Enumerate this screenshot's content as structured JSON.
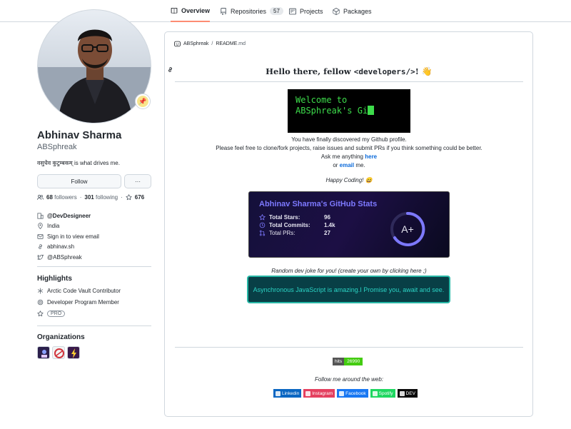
{
  "nav": {
    "tabs": [
      {
        "label": "Overview",
        "icon": "book-icon"
      },
      {
        "label": "Repositories",
        "icon": "repo-icon",
        "count": "57"
      },
      {
        "label": "Projects",
        "icon": "project-icon"
      },
      {
        "label": "Packages",
        "icon": "package-icon"
      }
    ]
  },
  "profile": {
    "name": "Abhinav Sharma",
    "login": "ABSphreak",
    "bio": "वसुधैव कुटुम्बकम् is what drives me.",
    "follow_label": "Follow",
    "more_label": "···",
    "followers_count": "68",
    "followers_label": "followers",
    "following_count": "301",
    "following_label": "following",
    "stars_count": "676",
    "company": "@DevDesigneer",
    "location": "India",
    "email": "Sign in to view email",
    "website": "abhinav.sh",
    "twitter": "@ABSphreak"
  },
  "highlights": {
    "title": "Highlights",
    "items": [
      "Arctic Code Vault Contributor",
      "Developer Program Member"
    ],
    "pro": "PRO"
  },
  "organizations": {
    "title": "Organizations",
    "colors": [
      "#2b1f4b",
      "#f4f4f4",
      "#3a1a4a"
    ]
  },
  "readme": {
    "owner": "ABSphreak",
    "separator": "/",
    "file": "README",
    "ext": ".md",
    "heading_start": "Hello there, fellow ",
    "heading_code": "<developers/>",
    "heading_end": "!",
    "terminal_line1": "Welcome to",
    "terminal_line2": "ABSphreak's Gi",
    "line1": "You have finally discovered my Github profile.",
    "line2": "Please feel free to clone/fork projects, raise issues and submit PRs if you think something could be better.",
    "line3_text": "Ask me anything ",
    "line3_link": "here",
    "line4_pre": "or ",
    "line4_link": "email",
    "line4_post": " me.",
    "happy": "Happy Coding! ",
    "stats": {
      "title": "Abhinav Sharma's GitHub Stats",
      "rows": [
        {
          "label": "Total Stars:",
          "value": "96"
        },
        {
          "label": "Total Commits:",
          "value": "1.4k"
        },
        {
          "label": "Total PRs:",
          "value": "27"
        }
      ],
      "grade": "A+",
      "title_color": "#7d79ff",
      "ring_color": "#7d79ff"
    },
    "joke_label": "Random dev joke for you! (create your own by clicking here ;)",
    "joke": "Asynchronous JavaScript is amazing.I Promise you, await and see.",
    "hits_label": "hits",
    "hits_value": "26990",
    "follow_web": "Follow me around the web:",
    "socials": [
      {
        "label": "Linkedin",
        "color": "#0a66c2"
      },
      {
        "label": "Instagram",
        "color": "#e4405f"
      },
      {
        "label": "Facebook",
        "color": "#1877f2"
      },
      {
        "label": "Spotify",
        "color": "#1ed760"
      },
      {
        "label": "DEV",
        "color": "#0a0a0a"
      }
    ]
  }
}
